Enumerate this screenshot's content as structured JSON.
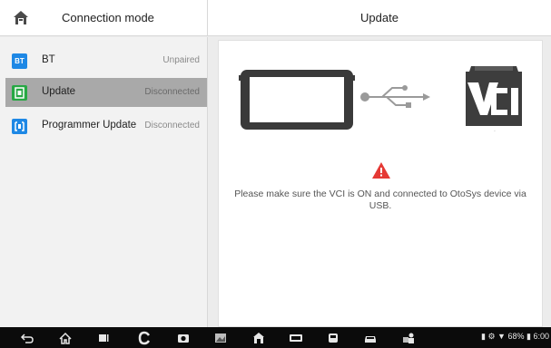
{
  "header": {
    "left_title": "Connection mode",
    "right_title": "Update"
  },
  "sidebar": {
    "items": [
      {
        "label": "BT",
        "status": "Unpaired",
        "icon": "bt-icon",
        "selected": false
      },
      {
        "label": "Update",
        "status": "Disconnected",
        "icon": "update-icon",
        "selected": true
      },
      {
        "label": "Programmer Update",
        "status": "Disconnected",
        "icon": "programmer-icon",
        "selected": false
      }
    ],
    "bt_icon_text": "BT"
  },
  "main": {
    "message": "Please make sure the VCI is ON and connected to OtoSys device via USB.",
    "vci_text": "VCI"
  },
  "statusbar": {
    "battery": "68%",
    "time": "6:00"
  },
  "colors": {
    "accent": "#1e88e5",
    "update_icon": "#27a844",
    "warning": "#e53935",
    "selected_bg": "#a9a9a9"
  }
}
